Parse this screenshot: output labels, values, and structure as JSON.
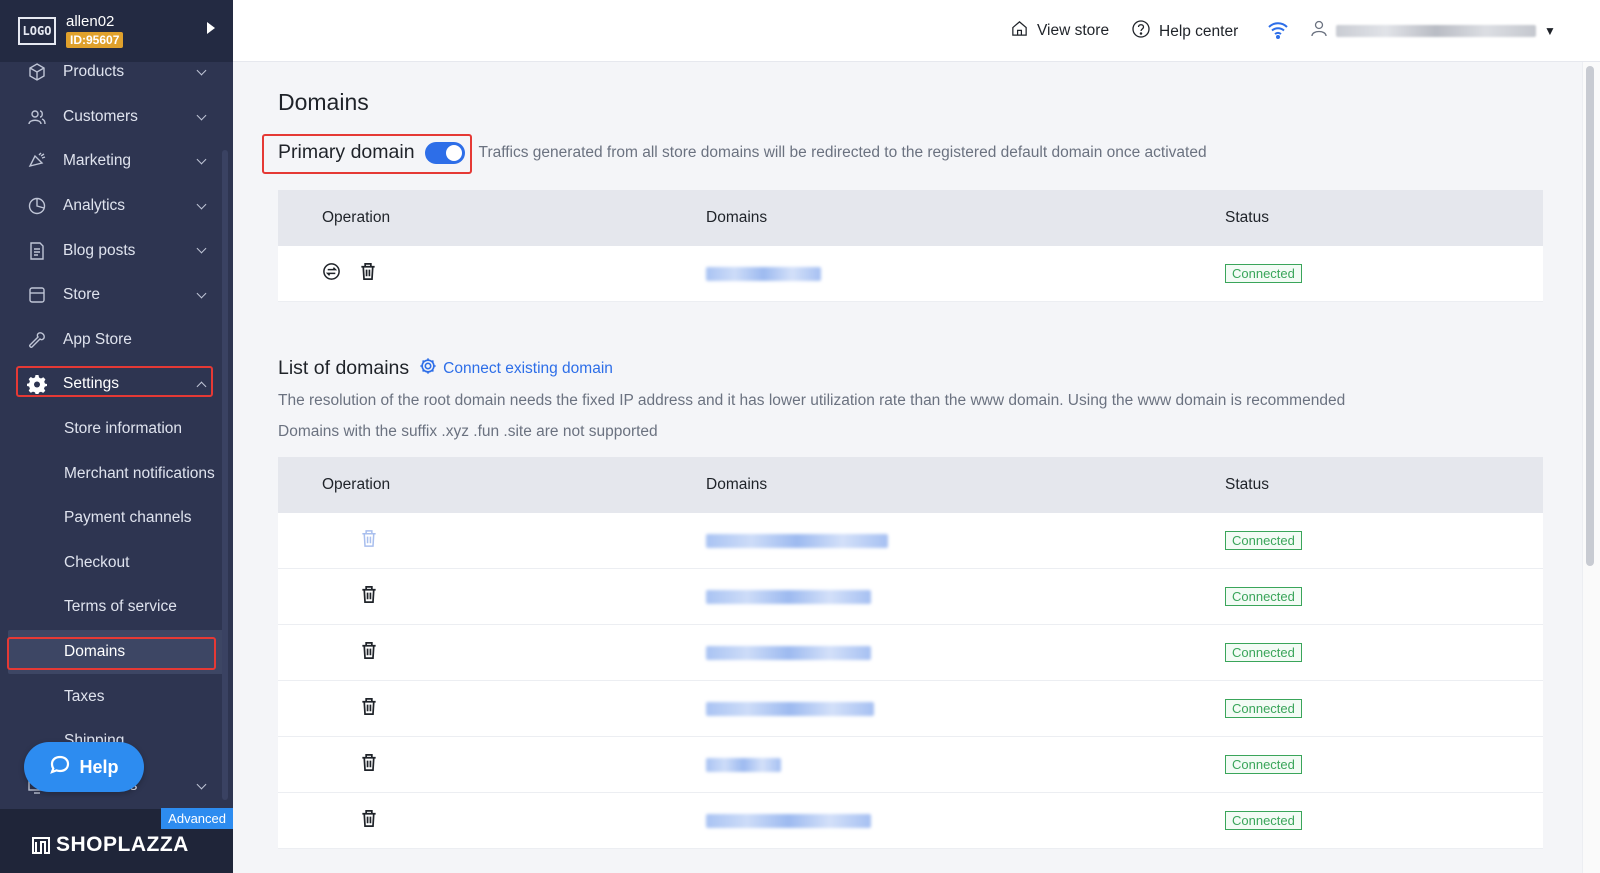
{
  "sidebar": {
    "logo_text": "LOGO",
    "account_name": "allen02",
    "account_id": "ID:95607",
    "nav": [
      {
        "label": "Products"
      },
      {
        "label": "Customers"
      },
      {
        "label": "Marketing"
      },
      {
        "label": "Analytics"
      },
      {
        "label": "Blog posts"
      },
      {
        "label": "Store"
      },
      {
        "label": "App Store"
      },
      {
        "label": "Settings"
      }
    ],
    "settings_sub": [
      {
        "label": "Store information"
      },
      {
        "label": "Merchant notifications"
      },
      {
        "label": "Payment channels"
      },
      {
        "label": "Checkout"
      },
      {
        "label": "Terms of service"
      },
      {
        "label": "Domains"
      },
      {
        "label": "Taxes"
      },
      {
        "label": "Shipping"
      }
    ],
    "partial_item": "es",
    "help_label": "Help",
    "badge": "Advanced",
    "brand": "SHOPLAZZA"
  },
  "topbar": {
    "view_store": "View store",
    "help_center": "Help center"
  },
  "main": {
    "title": "Domains",
    "primary_domain_label": "Primary domain",
    "primary_domain_enabled": true,
    "primary_domain_hint": "Traffics generated from all store domains will be redirected to the registered default domain once activated",
    "columns": [
      "Operation",
      "Domains",
      "Status"
    ],
    "primary_rows": [
      {
        "status": "Connected"
      }
    ],
    "list_title": "List of domains",
    "connect_link": "Connect existing domain",
    "note1": "The resolution of the root domain needs the fixed IP address and it has lower utilization rate than the www domain. Using the www domain is recommended",
    "note2": "Domains with the suffix .xyz .fun .site are not supported",
    "list_rows": [
      {
        "status": "Connected",
        "delete_disabled": true
      },
      {
        "status": "Connected",
        "delete_disabled": false
      },
      {
        "status": "Connected",
        "delete_disabled": false
      },
      {
        "status": "Connected",
        "delete_disabled": false
      },
      {
        "status": "Connected",
        "delete_disabled": false
      },
      {
        "status": "Connected",
        "delete_disabled": false
      }
    ]
  },
  "colors": {
    "sidebar_bg": "#2e3551",
    "accent": "#2d6ee8",
    "status_green": "#3aa55a",
    "highlight_red": "#e53935"
  }
}
